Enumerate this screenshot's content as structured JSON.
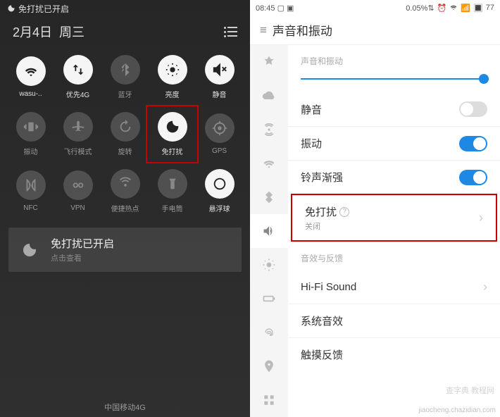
{
  "left": {
    "status_text": "免打扰已开启",
    "date": "2月4日",
    "weekday": "周三",
    "tiles": [
      {
        "label": "wasu-..",
        "icon": "wifi",
        "on": true
      },
      {
        "label": "优先4G",
        "icon": "data",
        "on": true
      },
      {
        "label": "蓝牙",
        "icon": "bluetooth",
        "on": false
      },
      {
        "label": "亮度",
        "icon": "brightness",
        "on": true
      },
      {
        "label": "静音",
        "icon": "mute",
        "on": true
      },
      {
        "label": "振动",
        "icon": "vibrate",
        "on": false
      },
      {
        "label": "飞行模式",
        "icon": "airplane",
        "on": false
      },
      {
        "label": "旋转",
        "icon": "rotate",
        "on": false
      },
      {
        "label": "免打扰",
        "icon": "dnd",
        "on": true,
        "highlight": true
      },
      {
        "label": "GPS",
        "icon": "gps",
        "on": false
      },
      {
        "label": "NFC",
        "icon": "nfc",
        "on": false
      },
      {
        "label": "VPN",
        "icon": "vpn",
        "on": false
      },
      {
        "label": "便捷热点",
        "icon": "hotspot",
        "on": false
      },
      {
        "label": "手电筒",
        "icon": "torch",
        "on": false
      },
      {
        "label": "悬浮球",
        "icon": "float",
        "on": true
      }
    ],
    "notif_title": "免打扰已开启",
    "notif_sub": "点击查看",
    "carrier": "中国移动4G"
  },
  "right": {
    "time": "08:45",
    "data_pct": "0.05%",
    "battery": "77",
    "title": "声音和振动",
    "section1": "声音和振动",
    "rows": {
      "mute": "静音",
      "vibrate": "振动",
      "fade": "铃声渐强",
      "dnd": "免打扰",
      "dnd_sub": "关闭",
      "section2": "音效与反馈",
      "hifi": "Hi-Fi Sound",
      "sysfx": "系统音效",
      "touch": "触摸反馈"
    }
  },
  "watermark1": "查字典  教程网",
  "watermark2": "jiaocheng.chazidian.com"
}
